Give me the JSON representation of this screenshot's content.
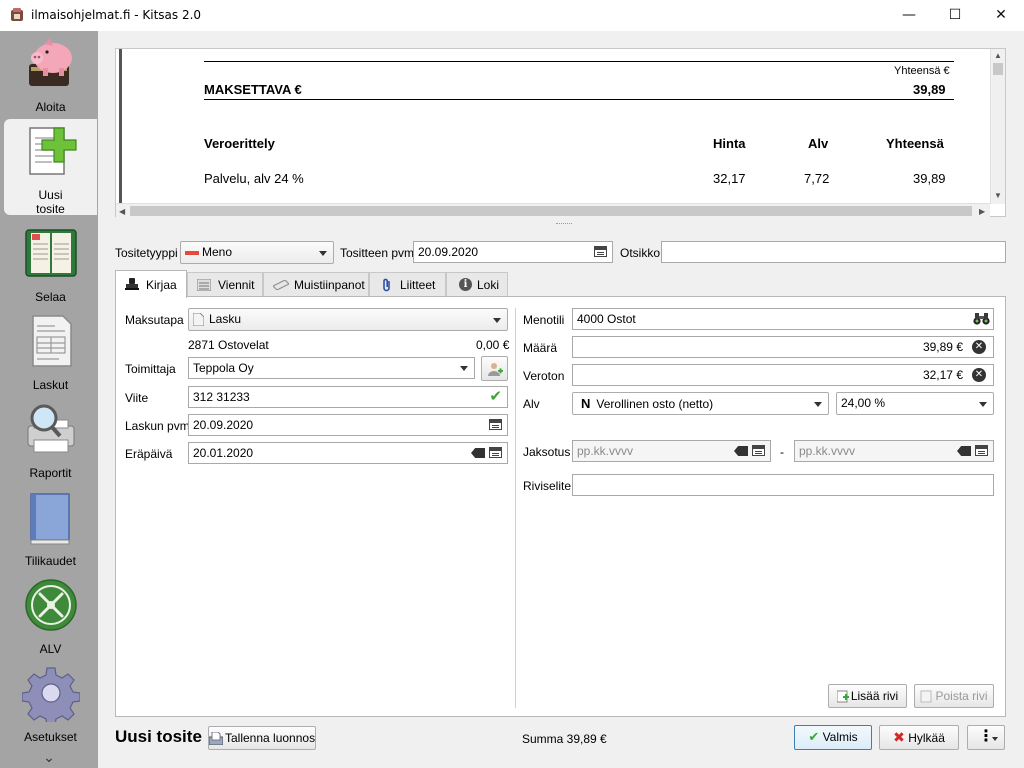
{
  "window": {
    "title": "ilmaisohjelmat.fi - Kitsas 2.0",
    "minimize": "—",
    "maximize": "☐",
    "close": "✕"
  },
  "sidebar": {
    "items": [
      {
        "label": "Aloita",
        "icon": "piggy-bank-icon"
      },
      {
        "label": "Uusi\ntosite",
        "icon": "new-document-icon",
        "active": true
      },
      {
        "label": "Selaa",
        "icon": "ledger-book-icon"
      },
      {
        "label": "Laskut",
        "icon": "invoice-icon"
      },
      {
        "label": "Raportit",
        "icon": "magnifier-printer-icon"
      },
      {
        "label": "Tilikaudet",
        "icon": "blue-book-icon"
      },
      {
        "label": "ALV",
        "icon": "tax-emblem-icon"
      },
      {
        "label": "Asetukset",
        "icon": "gear-icon"
      }
    ],
    "more": "⌄"
  },
  "preview": {
    "total_caption": "Yhteensä €",
    "payable_label": "MAKSETTAVA €",
    "payable_amount": "39,89",
    "vat_heading": "Veroerittely",
    "col_price": "Hinta",
    "col_vat": "Alv",
    "col_total": "Yhteensä",
    "row_label": "Palvelu, alv 24 %",
    "row_price": "32,17",
    "row_vat": "7,72",
    "row_total": "39,89"
  },
  "header": {
    "type_label": "Tositetyyppi",
    "type_value": "Meno",
    "date_label": "Tositteen pvm",
    "date_value": "20.09.2020",
    "title_label": "Otsikko",
    "title_value": ""
  },
  "tabs": [
    {
      "label": "Kirjaa",
      "icon": "stamp-icon"
    },
    {
      "label": "Viennit",
      "icon": "list-icon"
    },
    {
      "label": "Muistiinpanot",
      "icon": "notes-icon"
    },
    {
      "label": "Liitteet",
      "icon": "paperclip-icon"
    },
    {
      "label": "Loki",
      "icon": "info-icon"
    }
  ],
  "left": {
    "payment_label": "Maksutapa",
    "payment_value": "Lasku",
    "account_info": "2871 Ostovelat",
    "account_amount": "0,00 €",
    "supplier_label": "Toimittaja",
    "supplier_value": "Teppola Oy",
    "reference_label": "Viite",
    "reference_value": "312 31233",
    "invoice_date_label": "Laskun pvm",
    "invoice_date_value": "20.09.2020",
    "due_date_label": "Eräpäivä",
    "due_date_value": "20.01.2020"
  },
  "right": {
    "account_label": "Menotili",
    "account_value": "4000 Ostot",
    "amount_label": "Määrä",
    "amount_value": "39,89 €",
    "net_label": "Veroton",
    "net_value": "32,17 €",
    "vat_label": "Alv",
    "vat_code": "N",
    "vat_value": "Verollinen osto (netto)",
    "vat_rate": "24,00 %",
    "period_label": "Jaksotus",
    "period_start_placeholder": "pp.kk.vvvv",
    "period_dash": "-",
    "period_end_placeholder": "pp.kk.vvvv",
    "row_note_label": "Riviselite",
    "row_note_value": "",
    "add_row": "Lisää rivi",
    "remove_row": "Poista rivi"
  },
  "footer": {
    "title": "Uusi tosite",
    "save_draft": "Tallenna luonnos",
    "sum": "Summa 39,89 €",
    "ok": "Valmis",
    "reject": "Hylkää",
    "more": "⋮"
  },
  "colors": {
    "sidebar": "#a4a4a4",
    "meno_marker": "#e8483a",
    "check_green": "#3aa53a",
    "reject_red": "#d32626"
  }
}
